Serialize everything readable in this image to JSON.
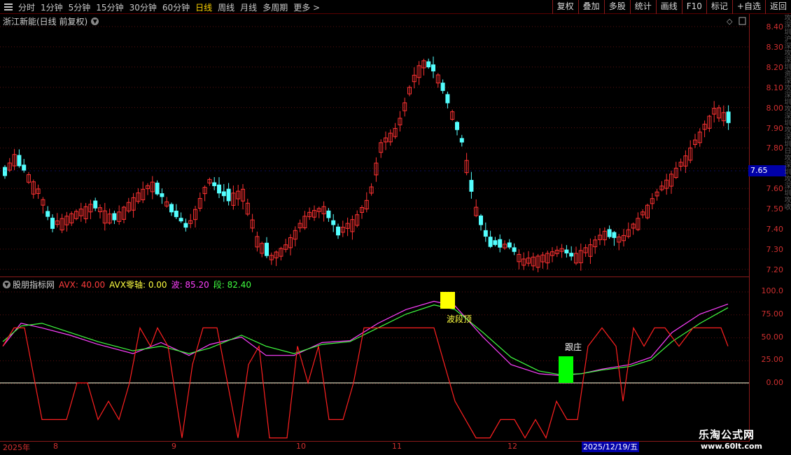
{
  "toolbar": {
    "periods": [
      "分时",
      "1分钟",
      "5分钟",
      "15分钟",
      "30分钟",
      "60分钟",
      "日线",
      "周线",
      "月线",
      "多周期",
      "更多 >"
    ],
    "active_period": "日线",
    "buttons": [
      "复权",
      "叠加",
      "多股",
      "统计",
      "画线",
      "F10",
      "标记",
      "+自选",
      "返回"
    ]
  },
  "main_chart": {
    "title": "浙江新能(日线 前复权)",
    "current_price": "7.65",
    "price_ticks": [
      "8.40",
      "8.30",
      "8.20",
      "8.10",
      "8.00",
      "7.90",
      "7.80",
      "7.70",
      "7.60",
      "7.50",
      "7.40",
      "7.30",
      "7.20"
    ],
    "up_color": "#ff3232",
    "down_color": "#54ffff"
  },
  "indicator": {
    "name": "股朋指标网",
    "items": [
      {
        "label": "AVX: 40.00",
        "color": "#ff3c3c"
      },
      {
        "label": "AVX零轴: 0.00",
        "color": "#ffff40"
      },
      {
        "label": "波: 85.20",
        "color": "#ff40ff"
      },
      {
        "label": "段: 82.40",
        "color": "#40ff40"
      }
    ],
    "ticks": [
      "100.0",
      "75.00",
      "50.00",
      "25.00",
      "0.00"
    ],
    "annotations": {
      "top_label": "波段顶",
      "buy_label": "跟庄"
    }
  },
  "time_axis": {
    "year": "2025年",
    "months": [
      "8",
      "9",
      "10",
      "11",
      "12"
    ],
    "highlight_date": "2025/12/19/五"
  },
  "watermark": {
    "line1": "乐淘公式网",
    "line2": "www.60lt.com"
  },
  "side_strip": "攻深圳沪深攻深圳资深攻深圳攻深圳攻深圳日攻深圳攻深圳攻收"
}
